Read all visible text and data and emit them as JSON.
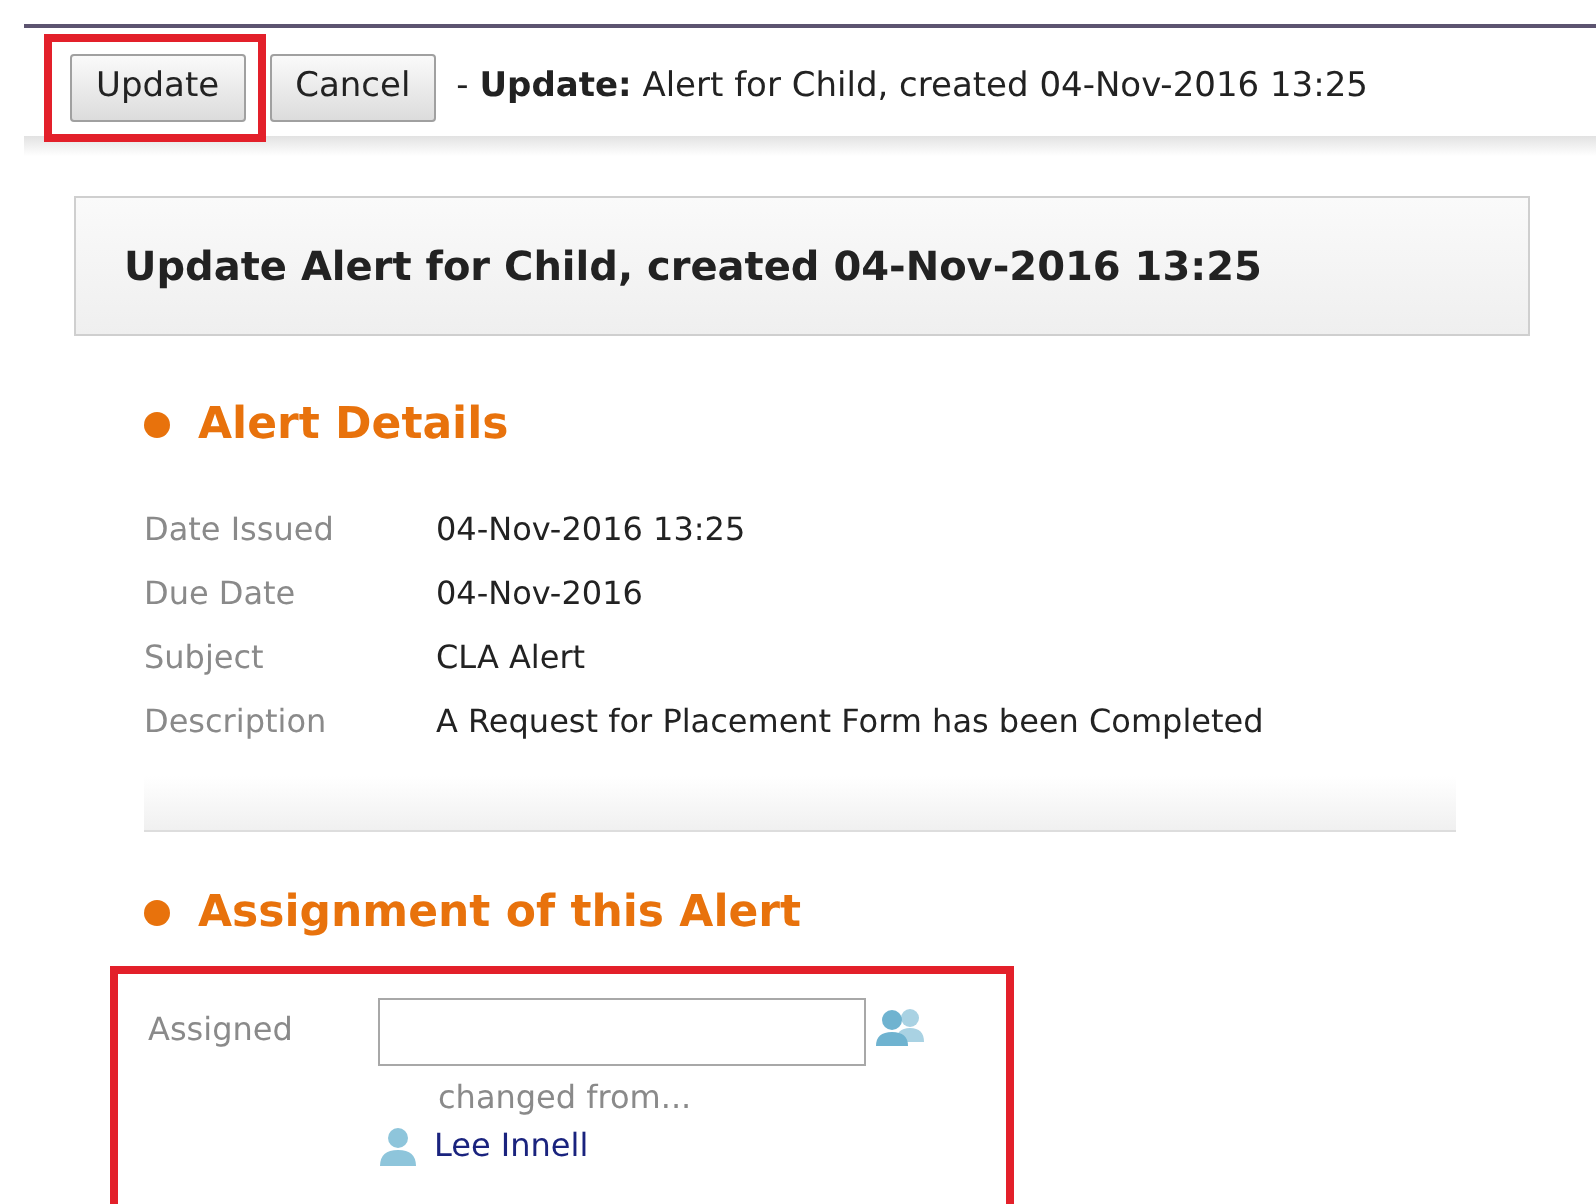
{
  "toolbar": {
    "buttons": [
      {
        "label": "Update",
        "highlighted": true
      },
      {
        "label": "Cancel",
        "highlighted": false
      }
    ],
    "caption_prefix": "- **Update:** Alert for Child, created 04-Nov-2016 13:25"
  },
  "header": {
    "title": "Update Alert for Child, created 04-Nov-2016 13:25"
  },
  "alert_details": {
    "heading": "Alert Details",
    "fields": [
      {
        "label": "Date Issued",
        "value": "04-Nov-2016 13:25"
      },
      {
        "label": "Due Date",
        "value": "04-Nov-2016"
      },
      {
        "label": "Subject",
        "value": "CLA Alert"
      },
      {
        "label": "Description",
        "value": "A Request for Placement Form has been Completed"
      }
    ]
  },
  "assignment": {
    "heading": "Assignment of this Alert",
    "highlighted": true,
    "label": "Assigned",
    "changed_from": "changed from...",
    "previous_assignee": "Lee Innell"
  }
}
